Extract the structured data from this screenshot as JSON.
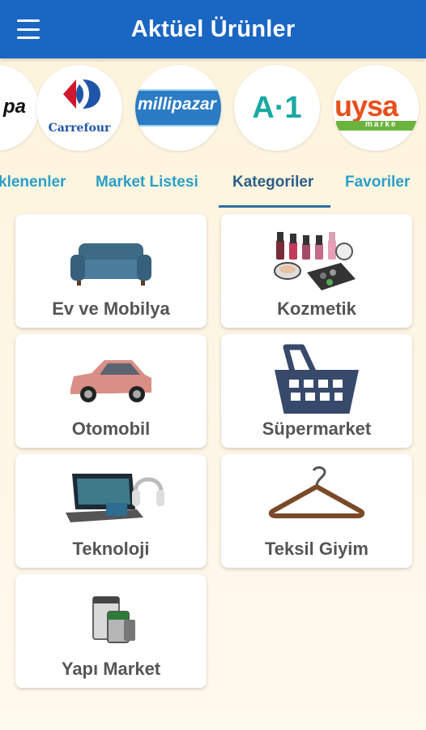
{
  "appbar": {
    "title": "Aktüel Ürünler",
    "menu_icon": "hamburger-menu-icon",
    "color": "#1a66c3"
  },
  "stores": [
    {
      "name": "pa",
      "icon": "store-logo-partial-icon"
    },
    {
      "name": "Carrefour",
      "icon": "carrefour-logo-icon"
    },
    {
      "name": "millipazar",
      "icon": "millipazar-logo-icon"
    },
    {
      "name": "A·1",
      "icon": "a101-logo-icon"
    },
    {
      "name": "uysa",
      "sub": "marke",
      "icon": "uysal-market-logo-icon"
    }
  ],
  "tabs": [
    {
      "label": "klenenler",
      "active": false
    },
    {
      "label": "Market Listesi",
      "active": false
    },
    {
      "label": "Kategoriler",
      "active": true
    },
    {
      "label": "Favoriler",
      "active": false
    }
  ],
  "categories": [
    {
      "label": "Ev ve Mobilya",
      "icon": "sofa-icon"
    },
    {
      "label": "Kozmetik",
      "icon": "cosmetics-icon"
    },
    {
      "label": "Otomobil",
      "icon": "car-icon"
    },
    {
      "label": "Süpermarket",
      "icon": "shopping-basket-icon"
    },
    {
      "label": "Teknoloji",
      "icon": "laptop-headphones-icon"
    },
    {
      "label": "Teksil Giyim",
      "icon": "clothes-hanger-icon"
    },
    {
      "label": "Yapı Market",
      "icon": "paint-can-icon"
    }
  ]
}
